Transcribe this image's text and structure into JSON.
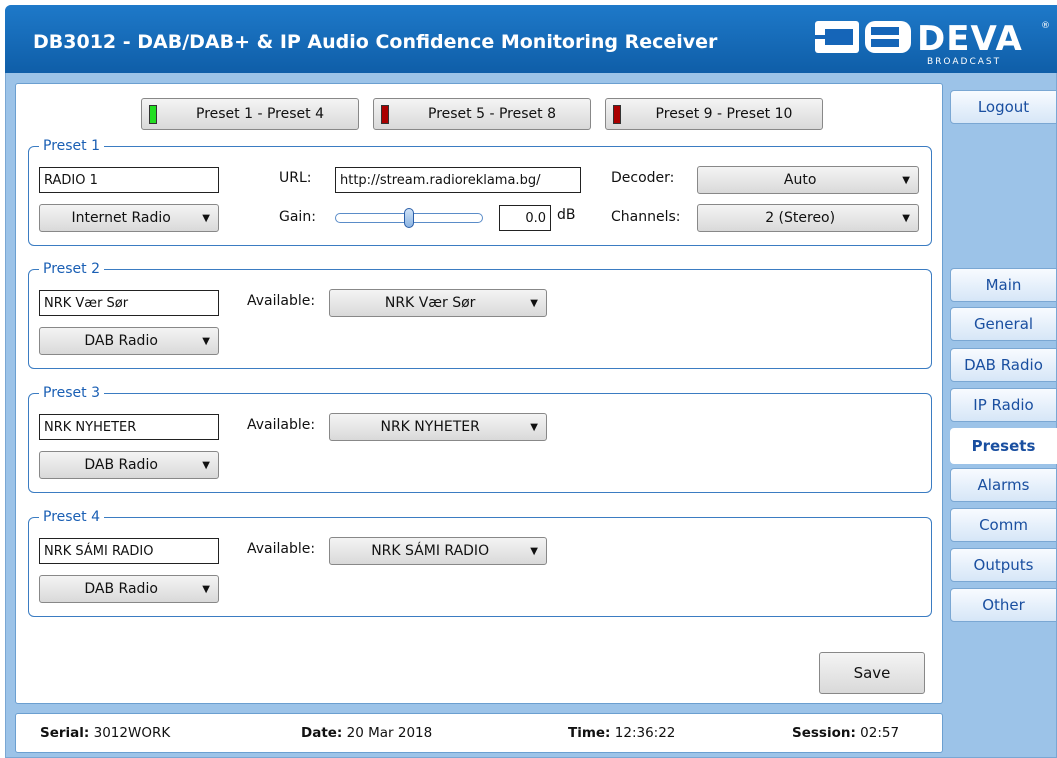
{
  "header": {
    "title": "DB3012 - DAB/DAB+ & IP Audio Confidence Monitoring Receiver",
    "logo_text": "DEVA",
    "logo_sub": "BROADCAST",
    "logo_reg": "®"
  },
  "preset_tabs": [
    {
      "label": "Preset 1 - Preset 4",
      "led": "on"
    },
    {
      "label": "Preset 5 - Preset 8",
      "led": "off"
    },
    {
      "label": "Preset 9 - Preset 10",
      "led": "off"
    }
  ],
  "preset1": {
    "legend": "Preset 1",
    "name": "RADIO 1",
    "source": "Internet Radio",
    "url_label": "URL:",
    "url": "http://stream.radioreklama.bg/",
    "gain_label": "Gain:",
    "gain_value": "0.0",
    "gain_unit": "dB",
    "gain_level": 0.5,
    "decoder_label": "Decoder:",
    "decoder": "Auto",
    "channels_label": "Channels:",
    "channels": "2 (Stereo)"
  },
  "preset2": {
    "legend": "Preset 2",
    "name": "NRK Vær Sør",
    "available_label": "Available:",
    "available": "NRK Vær Sør",
    "source": "DAB Radio"
  },
  "preset3": {
    "legend": "Preset 3",
    "name": "NRK NYHETER",
    "available_label": "Available:",
    "available": "NRK NYHETER",
    "source": "DAB Radio"
  },
  "preset4": {
    "legend": "Preset 4",
    "name": "NRK SÁMI RADIO",
    "available_label": "Available:",
    "available": "NRK SÁMI RADIO",
    "source": "DAB Radio"
  },
  "save_label": "Save",
  "sidebar": {
    "logout": "Logout",
    "items": [
      {
        "label": "Main",
        "active": false
      },
      {
        "label": "General",
        "active": false
      },
      {
        "label": "DAB Radio",
        "active": false
      },
      {
        "label": "IP Radio",
        "active": false
      },
      {
        "label": "Presets",
        "active": true
      },
      {
        "label": "Alarms",
        "active": false
      },
      {
        "label": "Comm",
        "active": false
      },
      {
        "label": "Outputs",
        "active": false
      },
      {
        "label": "Other",
        "active": false
      }
    ]
  },
  "footer": {
    "serial_label": "Serial:",
    "serial": "3012WORK",
    "date_label": "Date:",
    "date": "20 Mar 2018",
    "time_label": "Time:",
    "time": "12:36:22",
    "session_label": "Session:",
    "session": "02:57"
  },
  "colors": {
    "header": "#1565b8",
    "panel_border": "#6b9fd0",
    "legend": "#1a5fb4",
    "led_on": "#22dd22",
    "led_off": "#aa0000",
    "sidebar_bg": "#9cc3e8"
  },
  "icons": {
    "dropdown": "chevron-down-icon",
    "led": "status-led-icon"
  }
}
